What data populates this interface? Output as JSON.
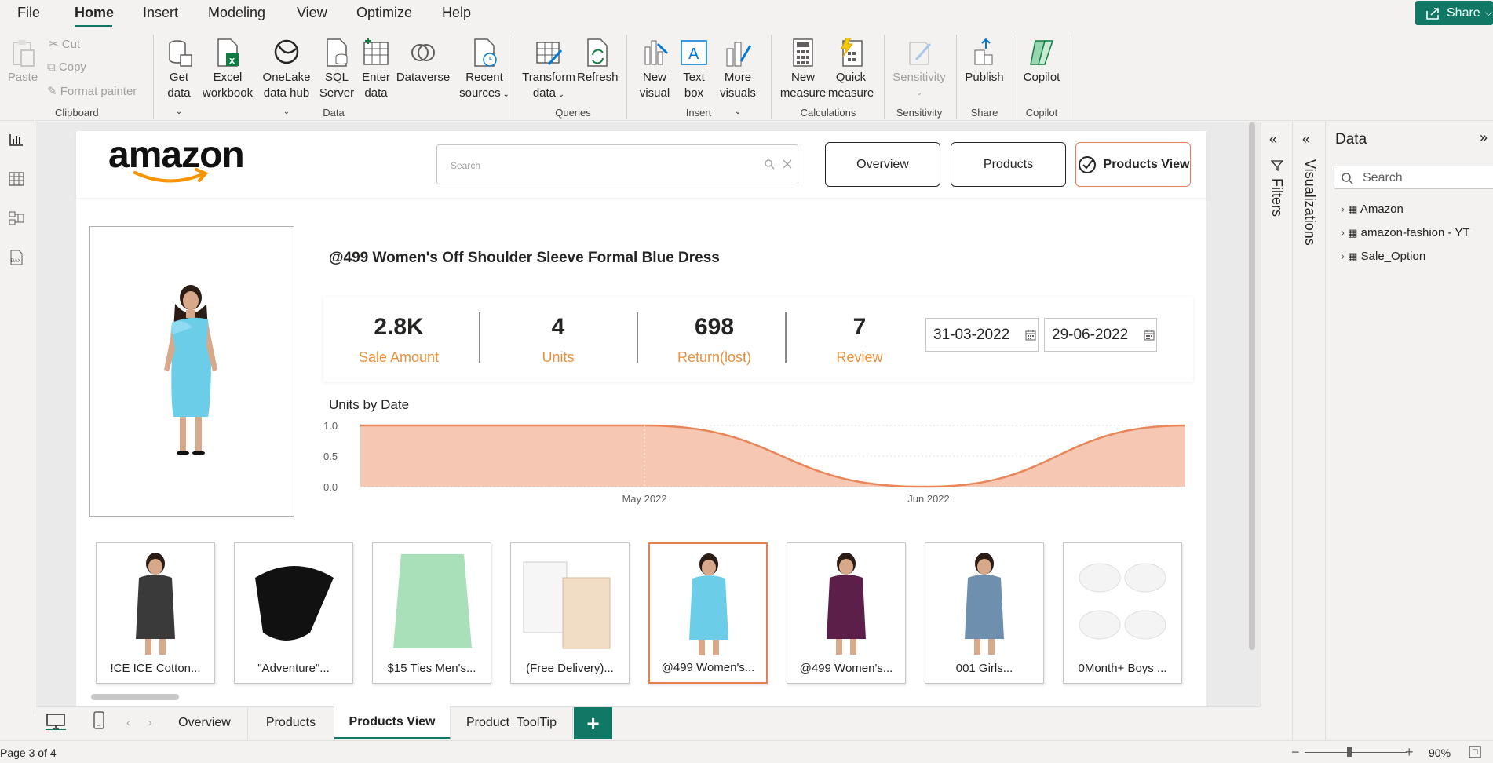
{
  "menu": {
    "items": [
      "File",
      "Home",
      "Insert",
      "Modeling",
      "View",
      "Optimize",
      "Help"
    ],
    "share": "Share"
  },
  "ribbon": {
    "clipboard": {
      "paste": "Paste",
      "cut": "Cut",
      "copy": "Copy",
      "format_painter": "Format painter",
      "group": "Clipboard"
    },
    "data": {
      "get_data": [
        "Get",
        "data"
      ],
      "excel": [
        "Excel",
        "workbook"
      ],
      "onelake": [
        "OneLake",
        "data hub"
      ],
      "sql": [
        "SQL",
        "Server"
      ],
      "enter": [
        "Enter",
        "data"
      ],
      "dataverse": "Dataverse",
      "recent": [
        "Recent",
        "sources"
      ],
      "group": "Data"
    },
    "queries": {
      "transform": [
        "Transform",
        "data"
      ],
      "refresh": "Refresh",
      "group": "Queries"
    },
    "insert": {
      "new_visual": [
        "New",
        "visual"
      ],
      "text_box": [
        "Text",
        "box"
      ],
      "more_visuals": [
        "More",
        "visuals"
      ],
      "group": "Insert"
    },
    "calculations": {
      "new_measure": [
        "New",
        "measure"
      ],
      "quick_measure": [
        "Quick",
        "measure"
      ],
      "group": "Calculations"
    },
    "sensitivity": {
      "label": "Sensitivity",
      "group": "Sensitivity"
    },
    "share": {
      "publish": "Publish",
      "group": "Share"
    },
    "copilot": {
      "label": "Copilot",
      "group": "Copilot"
    }
  },
  "report": {
    "logo": "amazon",
    "search_placeholder": "Search",
    "nav": [
      "Overview",
      "Products",
      "Products View"
    ],
    "product_title": "@499 Women's Off Shoulder Sleeve Formal Blue Dress",
    "kpis": [
      {
        "value": "2.8K",
        "label": "Sale Amount"
      },
      {
        "value": "4",
        "label": "Units"
      },
      {
        "value": "698",
        "label": "Return(lost)"
      },
      {
        "value": "7",
        "label": "Review"
      }
    ],
    "date_from": "31-03-2022",
    "date_to": "29-06-2022",
    "thumbnails": [
      "!CE ICE Cotton...",
      "\"Adventure\"...",
      "$15 Ties Men's...",
      "(Free Delivery)...",
      "@499 Women's...",
      "@499 Women's...",
      "001 Girls...",
      "0Month+ Boys ..."
    ],
    "selected_thumbnail": 4
  },
  "chart_data": {
    "type": "area",
    "title": "Units by Date",
    "x": [
      "2022-03-31",
      "2022-04-30",
      "2022-05-01",
      "2022-05-31",
      "2022-06-01",
      "2022-06-29"
    ],
    "values": [
      1,
      1,
      1,
      0,
      0,
      1
    ],
    "x_ticks": [
      "May 2022",
      "Jun 2022"
    ],
    "y_ticks": [
      "0.0",
      "0.5",
      "1.0"
    ],
    "ylim": [
      0,
      1
    ],
    "color": "#e8865a",
    "fill": "#f6c8b3"
  },
  "panes": {
    "filters": "Filters",
    "visualizations": "Visualizations",
    "data_title": "Data",
    "data_search": "Search",
    "tables": [
      "Amazon",
      "amazon-fashion - YT",
      "Sale_Option"
    ]
  },
  "tabs": [
    "Overview",
    "Products",
    "Products View",
    "Product_ToolTip"
  ],
  "active_tab": "Products View",
  "status": {
    "page": "Page 3 of 4",
    "zoom": "90%"
  }
}
